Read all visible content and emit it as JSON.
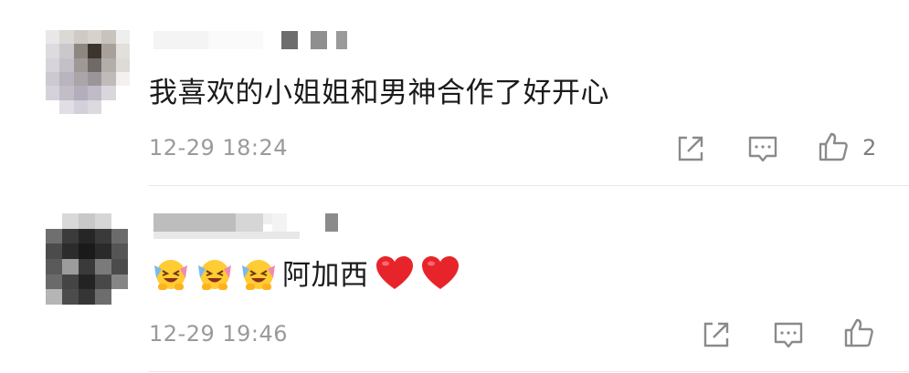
{
  "comments": [
    {
      "text": "我喜欢的小姐姐和男神合作了好开心",
      "time": "12-29 18:24",
      "likes": "2",
      "avatar_icon": "pixelated-avatar",
      "emojis": [],
      "hearts": 0
    },
    {
      "text": "阿加西",
      "time": "12-29 19:46",
      "likes": "",
      "avatar_icon": "pixelated-avatar",
      "emojis": [
        "crying-laughing-emoji",
        "crying-laughing-emoji",
        "crying-laughing-emoji"
      ],
      "hearts": 2
    }
  ],
  "actions": {
    "share_icon": "share-icon",
    "comment_icon": "comment-icon",
    "like_icon": "thumbs-up-icon"
  },
  "colors": {
    "text": "#1b1b1b",
    "meta": "#9a9a9a",
    "icon": "#8a8a8a",
    "heart": "#e8242b"
  }
}
